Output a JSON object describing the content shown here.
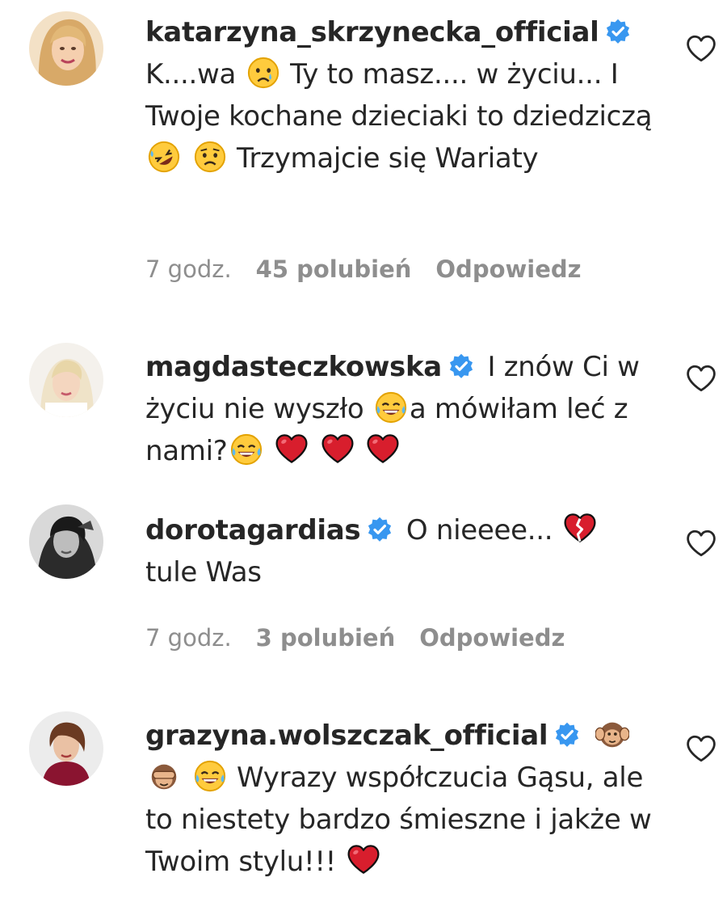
{
  "comments": [
    {
      "username": "katarzyna_skrzynecka_official",
      "verified": true,
      "text_1": "K....wa",
      "text_2": "Ty to masz.... w życiu... I Twoje kochane dzieciaki to dziedziczą",
      "text_3": "Trzymajcie się Wariaty",
      "time": "7 godz.",
      "likes": "45 polubień",
      "reply": "Odpowiedz"
    },
    {
      "username": "magdasteczkowska",
      "verified": true,
      "text_1": "I znów Ci w życiu nie wyszło",
      "text_2": "a mówiłam leć z nami?"
    },
    {
      "username": "dorotagardias",
      "verified": true,
      "text_1": "O nieeee...",
      "text_2": "tule Was",
      "time": "7 godz.",
      "likes": "3 polubień",
      "reply": "Odpowiedz"
    },
    {
      "username": "grazyna.wolszczak_official",
      "verified": true,
      "text_1": "Wyrazy współczucia Gąsu, ale to niestety bardzo śmieszne i jakże w Twoim stylu!!!"
    }
  ],
  "colors": {
    "text": "#262626",
    "meta": "#8e8e8e",
    "verified": "#3897f0",
    "heart_red": "#d81e2d"
  },
  "icons": [
    "verified-badge-icon",
    "heart-outline-icon",
    "crying-face-emoji",
    "rofl-emoji",
    "worried-face-emoji",
    "tears-of-joy-emoji",
    "red-heart-emoji",
    "broken-heart-emoji",
    "hear-no-evil-monkey-emoji",
    "see-no-evil-monkey-emoji"
  ]
}
